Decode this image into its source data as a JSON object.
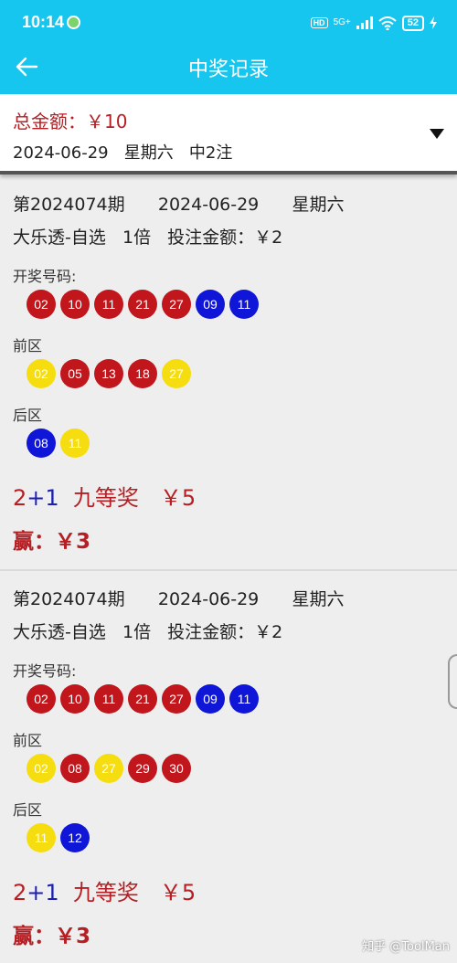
{
  "status": {
    "time": "10:14",
    "hd": "HD",
    "signal": "5G+",
    "battery": "52"
  },
  "nav": {
    "title": "中奖记录"
  },
  "summary": {
    "total": "总金额：￥10",
    "date_line": "2024-06-29   星期六   中2注"
  },
  "records": [
    {
      "header": "第2024074期      2024-06-29      星期六",
      "detail": "大乐透-自选   1倍   投注金额：￥2",
      "draw_label": "开奖号码:",
      "draw_numbers": [
        {
          "n": "02",
          "c": "red"
        },
        {
          "n": "10",
          "c": "red"
        },
        {
          "n": "11",
          "c": "red"
        },
        {
          "n": "21",
          "c": "red"
        },
        {
          "n": "27",
          "c": "red"
        },
        {
          "n": "09",
          "c": "blue"
        },
        {
          "n": "11",
          "c": "blue"
        }
      ],
      "front_label": "前区",
      "front_numbers": [
        {
          "n": "02",
          "c": "yellow"
        },
        {
          "n": "05",
          "c": "red"
        },
        {
          "n": "13",
          "c": "red"
        },
        {
          "n": "18",
          "c": "red"
        },
        {
          "n": "27",
          "c": "yellow"
        }
      ],
      "back_label": "后区",
      "back_numbers": [
        {
          "n": "08",
          "c": "blue"
        },
        {
          "n": "11",
          "c": "yellow"
        }
      ],
      "match_front": "2",
      "match_plus": "+",
      "match_back": "1",
      "prize_text": "  九等奖   ￥5",
      "win": "赢：￥3"
    },
    {
      "header": "第2024074期      2024-06-29      星期六",
      "detail": "大乐透-自选   1倍   投注金额：￥2",
      "draw_label": "开奖号码:",
      "draw_numbers": [
        {
          "n": "02",
          "c": "red"
        },
        {
          "n": "10",
          "c": "red"
        },
        {
          "n": "11",
          "c": "red"
        },
        {
          "n": "21",
          "c": "red"
        },
        {
          "n": "27",
          "c": "red"
        },
        {
          "n": "09",
          "c": "blue"
        },
        {
          "n": "11",
          "c": "blue"
        }
      ],
      "front_label": "前区",
      "front_numbers": [
        {
          "n": "02",
          "c": "yellow"
        },
        {
          "n": "08",
          "c": "red"
        },
        {
          "n": "27",
          "c": "yellow"
        },
        {
          "n": "29",
          "c": "red"
        },
        {
          "n": "30",
          "c": "red"
        }
      ],
      "back_label": "后区",
      "back_numbers": [
        {
          "n": "11",
          "c": "yellow"
        },
        {
          "n": "12",
          "c": "blue"
        }
      ],
      "match_front": "2",
      "match_plus": "+",
      "match_back": "1",
      "prize_text": "  九等奖   ￥5",
      "win": "赢：￥3"
    }
  ],
  "watermark": "知乎 @ToolMan",
  "colors": {
    "header_bg": "#17c6ee",
    "ball_red": "#c0161c",
    "ball_blue": "#1016d8",
    "ball_yellow": "#f5dd10",
    "prize_red": "#b51f24"
  }
}
